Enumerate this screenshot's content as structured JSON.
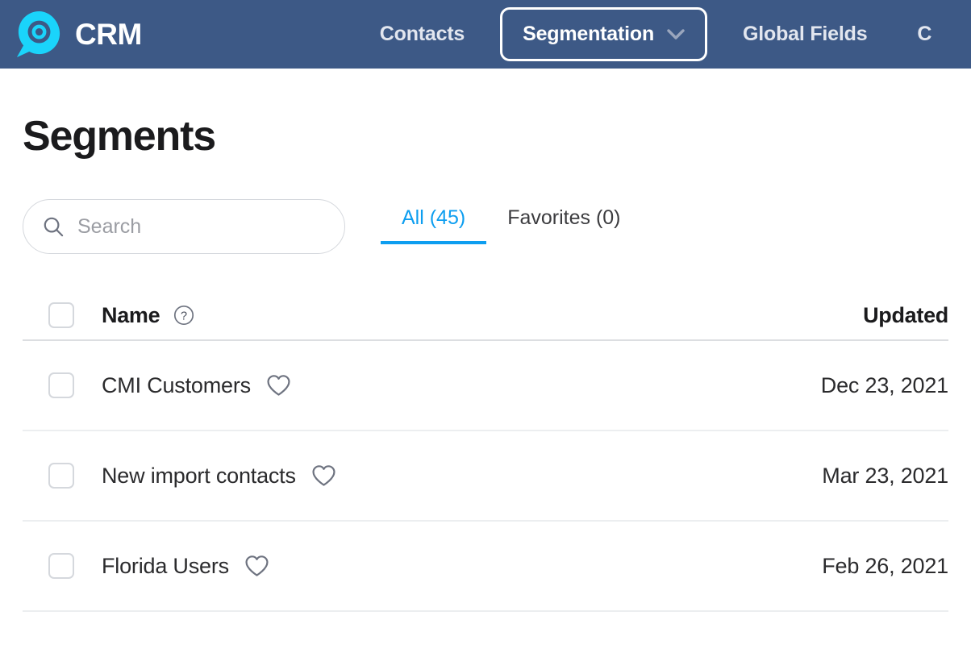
{
  "colors": {
    "header_bg": "#3d5986",
    "brand_cyan": "#1ad4fb",
    "accent_blue": "#0d9ef0",
    "text_dark": "#1b1b1d",
    "text_body": "#2b2b2d",
    "placeholder": "#9b9da3",
    "border_light": "#d5d8dd",
    "row_divider": "#eceef0"
  },
  "header": {
    "brand_name": "CRM",
    "logo_icon": "crm-bubble-logo",
    "nav": [
      {
        "label": "Contacts",
        "active": false,
        "has_caret": false
      },
      {
        "label": "Segmentation",
        "active": true,
        "has_caret": true,
        "caret_icon": "chevron-down-icon"
      },
      {
        "label": "Global Fields",
        "active": false,
        "has_caret": false
      }
    ],
    "overflow_label": "C"
  },
  "main": {
    "page_title": "Segments",
    "search": {
      "icon": "search-icon",
      "placeholder": "Search",
      "value": ""
    },
    "tabs": [
      {
        "label": "All (45)",
        "active": true
      },
      {
        "label": "Favorites (0)",
        "active": false
      }
    ],
    "table": {
      "columns": {
        "name": "Name",
        "name_help_icon": "question-circle-icon",
        "updated": "Updated"
      },
      "rows": [
        {
          "name": "CMI Customers",
          "favorite_icon": "heart-outline-icon",
          "favorited": false,
          "updated": "Dec 23, 2021",
          "checked": false
        },
        {
          "name": "New import contacts",
          "favorite_icon": "heart-outline-icon",
          "favorited": false,
          "updated": "Mar 23, 2021",
          "checked": false
        },
        {
          "name": "Florida Users",
          "favorite_icon": "heart-outline-icon",
          "favorited": false,
          "updated": "Feb 26, 2021",
          "checked": false
        }
      ]
    }
  }
}
